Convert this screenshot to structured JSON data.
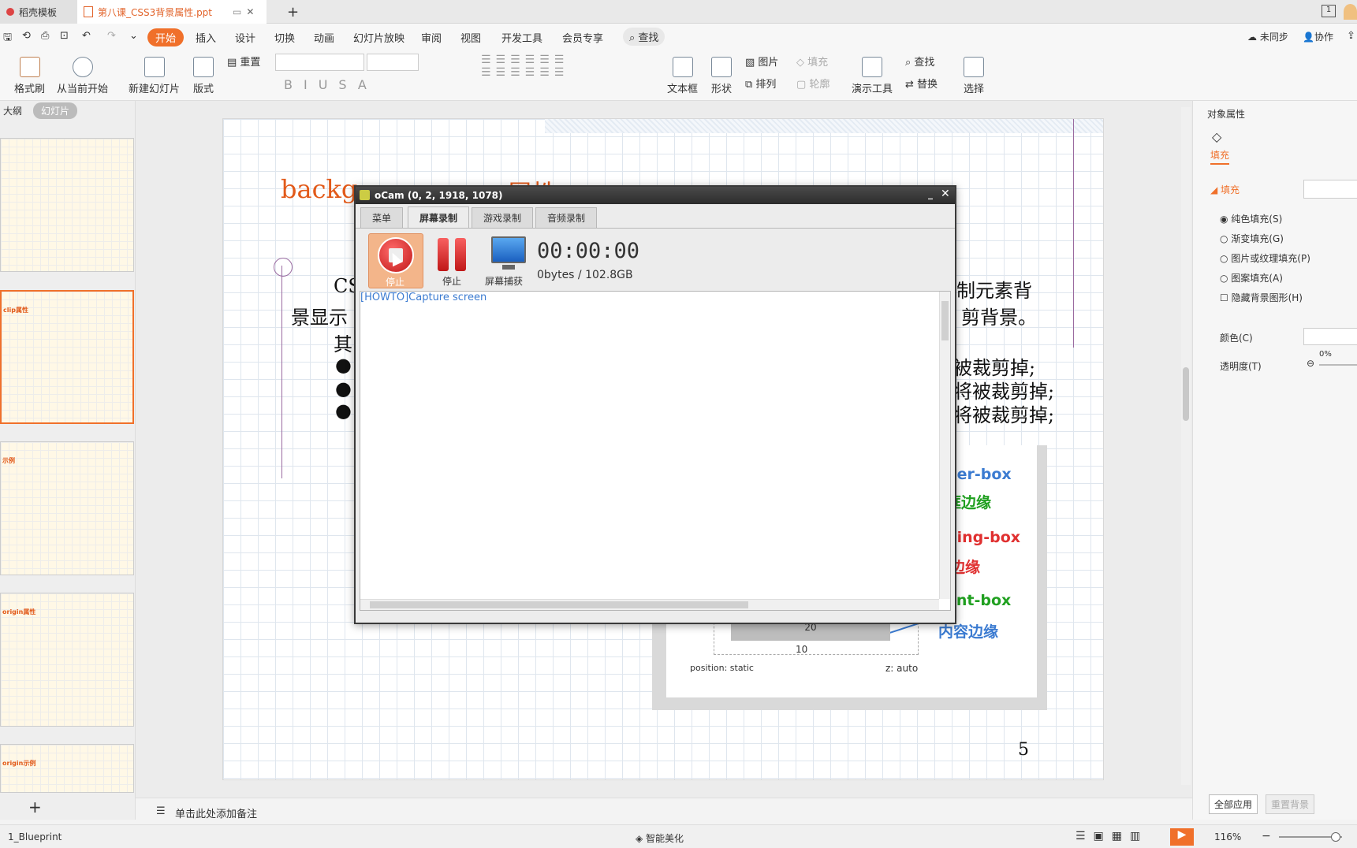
{
  "tabs": {
    "home": "稻壳模板",
    "doc": "第八课_CSS3背景属性.ppt",
    "add": "+"
  },
  "menu": {
    "items": [
      "开始",
      "插入",
      "设计",
      "切换",
      "动画",
      "幻灯片放映",
      "审阅",
      "视图",
      "开发工具",
      "会员专享"
    ],
    "search": "查找",
    "sync": "未同步",
    "collab": "协作"
  },
  "ribbon": {
    "format_painter": "格式刷",
    "from_current": "从当前开始",
    "new_slide": "新建幻灯片",
    "layout": "版式",
    "reset": "重置",
    "textbox": "文本框",
    "shape": "形状",
    "picture": "图片",
    "arrange": "排列",
    "fill": "填充",
    "outline": "轮廓",
    "present_tool": "演示工具",
    "find": "查找",
    "replace": "替换",
    "select": "选择"
  },
  "leftpane": {
    "outline_tab": "大纲",
    "slides_tab": "幻灯片",
    "thumb_titles": [
      "",
      "clip属性",
      "示例",
      "origin属性",
      "origin示例"
    ]
  },
  "slide": {
    "title_partial": "backg",
    "title_partial2": "属性",
    "line1a": "CS",
    "line1b": "制元素背",
    "line2a": "景显示",
    "line2b": "剪背景。",
    "line3a": "其",
    "bullet1": "被裁剪掉;",
    "bullet2": "将被裁剪掉;",
    "bullet3": "将被裁剪掉;",
    "label_border": "der-box",
    "label_border_cn": "框边缘",
    "label_padding": "ding-box",
    "label_padding_cn": "边缘",
    "label_content": "ent-box",
    "label_content_cn": "内容边缘",
    "box_20a": "20",
    "box_20b": "20",
    "box_10": "10",
    "position": "position: static",
    "z": "z: auto",
    "page_number": "5"
  },
  "ocam": {
    "title": "oCam (0, 2, 1918, 1078)",
    "tabs": [
      "菜单",
      "屏幕录制",
      "游戏录制",
      "音频录制"
    ],
    "stop_label": "停止",
    "pause_label": "停止",
    "capture_label": "屏幕捕获",
    "timer": "00:00:00",
    "size": "0bytes / 102.8GB",
    "link": "[HOWTO]Capture screen"
  },
  "rightpane": {
    "header": "对象属性",
    "fill_tab": "填充",
    "fill_section": "填充",
    "options": [
      "纯色填充(S)",
      "渐变填充(G)",
      "图片或纹理填充(P)",
      "图案填充(A)"
    ],
    "hide_bg": "隐藏背景图形(H)",
    "color_label": "颜色(C)",
    "transparency_label": "透明度(T)",
    "transparency_value": "0%",
    "apply_all": "全部应用",
    "reset_bg": "重置背景"
  },
  "notes": "单击此处添加备注",
  "status": {
    "theme": "1_Blueprint",
    "beautify": "智能美化",
    "zoom": "116%"
  },
  "colors": {
    "accent_orange": "#f0702a",
    "ocam_red": "#d42020",
    "blue_link": "#3b7bd1"
  }
}
